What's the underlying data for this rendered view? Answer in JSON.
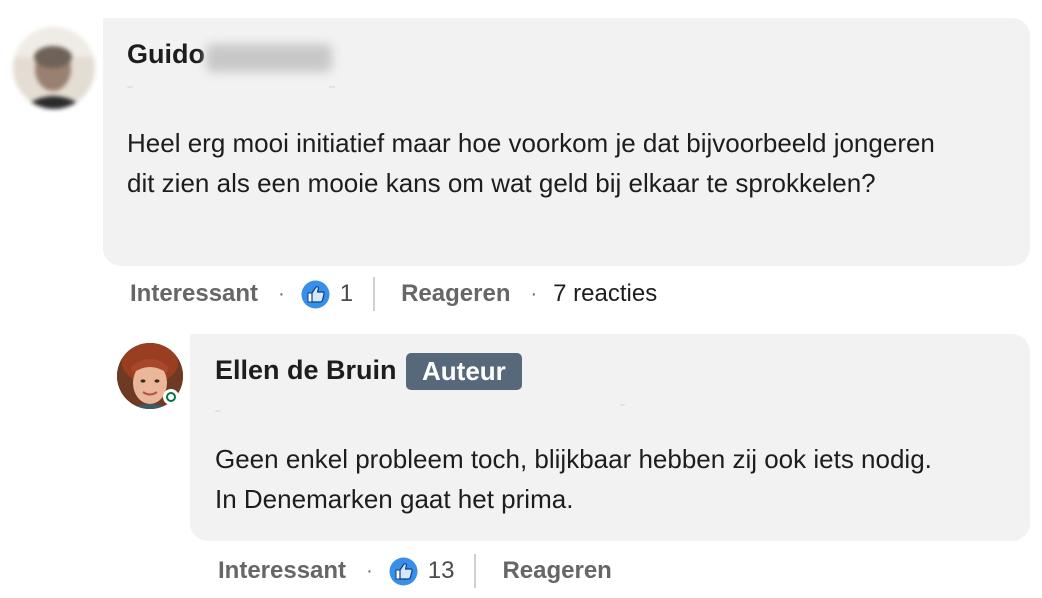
{
  "comments": [
    {
      "author_first_name": "Guido",
      "text": "Heel erg mooi initiatief maar hoe voorkom je dat bijvoorbeeld jongeren dit zien als een mooie kans om wat geld bij elkaar te sprokkelen?",
      "actions": {
        "like_label": "Interessant",
        "reaction_count": "1",
        "reply_label": "Reageren",
        "replies_count": "7 reacties"
      }
    },
    {
      "author_name": "Ellen de Bruin",
      "badge": "Auteur",
      "text": "Geen enkel probleem toch, blijkbaar hebben zij ook iets nodig. In Denemarken gaat het prima.",
      "actions": {
        "like_label": "Interessant",
        "reaction_count": "13",
        "reply_label": "Reageren"
      }
    }
  ],
  "separator": "·",
  "icons": {
    "reaction": "thumbs-up-icon",
    "online": "online-status-icon"
  },
  "colors": {
    "bubble": "#f2f2f2",
    "badge": "#56687a",
    "like_blue": "#378fe9",
    "online_green": "#057642"
  }
}
